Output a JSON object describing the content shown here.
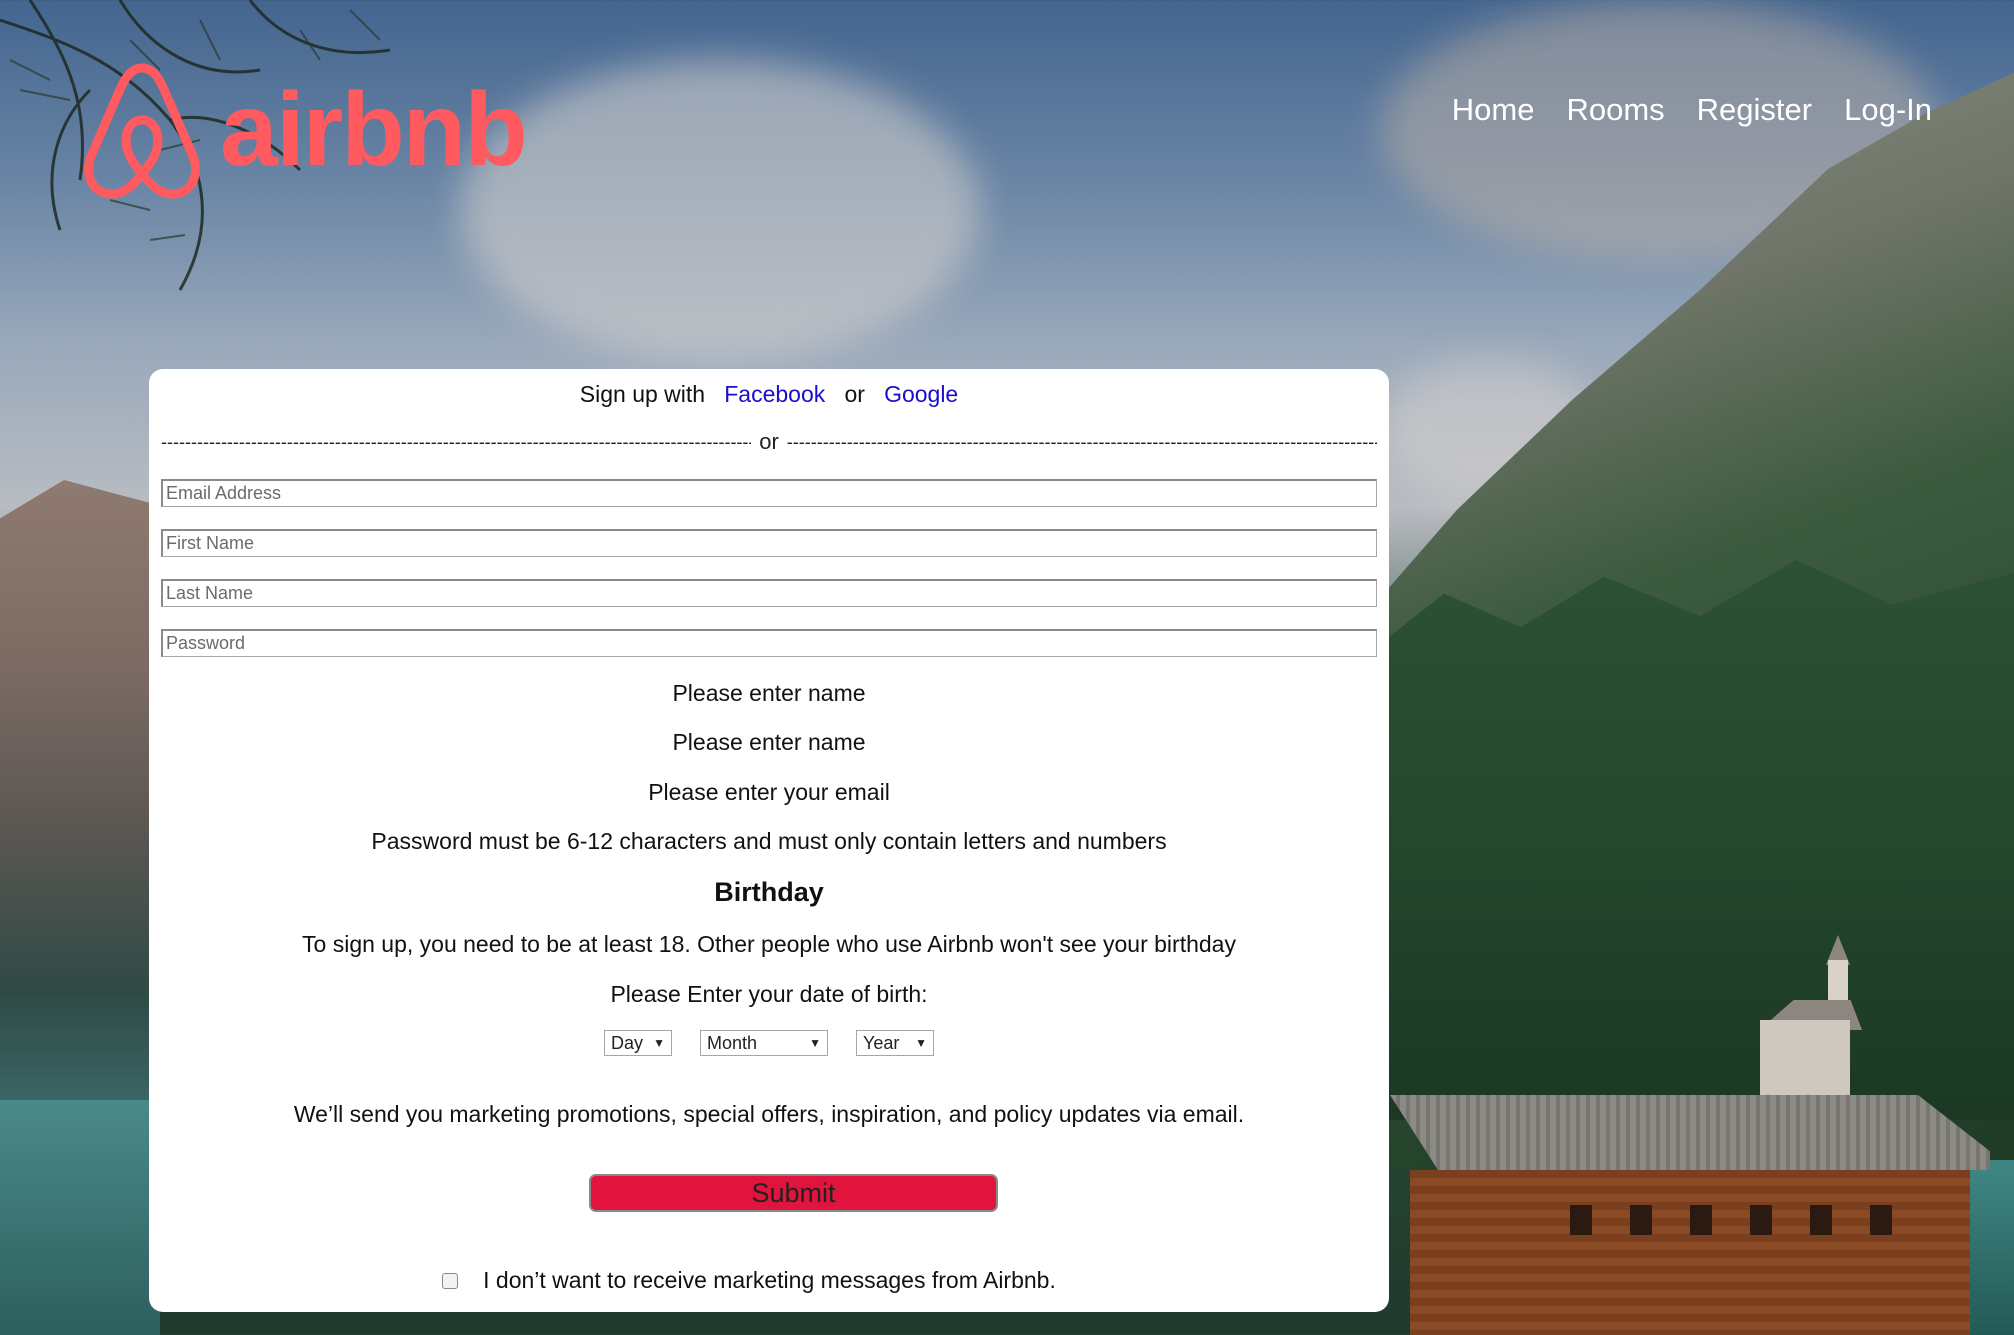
{
  "brand": {
    "name": "airbnb",
    "color": "#ff5a5f"
  },
  "nav": {
    "items": [
      {
        "label": "Home"
      },
      {
        "label": "Rooms"
      },
      {
        "label": "Register"
      },
      {
        "label": "Log-In"
      }
    ]
  },
  "form": {
    "signup_prefix": "Sign up with",
    "facebook_label": "Facebook",
    "or_label": "or",
    "google_label": "Google",
    "divider_label": "or",
    "fields": {
      "email_placeholder": "Email Address",
      "first_name_placeholder": "First Name",
      "last_name_placeholder": "Last Name",
      "password_placeholder": "Password"
    },
    "messages": {
      "first_name_error": "Please enter name",
      "last_name_error": "Please enter name",
      "email_error": "Please enter your email",
      "password_error": "Password must be 6-12 characters and must only contain letters and numbers"
    },
    "birthday": {
      "heading": "Birthday",
      "note": "To sign up, you need to be at least 18. Other people who use Airbnb won't see your birthday",
      "prompt": "Please Enter your date of birth:",
      "day_value": "Day",
      "month_value": "Month",
      "year_value": "Year"
    },
    "marketing_notice": "We’ll send you marketing promotions, special offers, inspiration, and policy updates via email.",
    "submit_label": "Submit",
    "submit_color": "#e0143c",
    "optout_label": "I don’t want to receive marketing messages from Airbnb.",
    "optout_checked": false
  }
}
